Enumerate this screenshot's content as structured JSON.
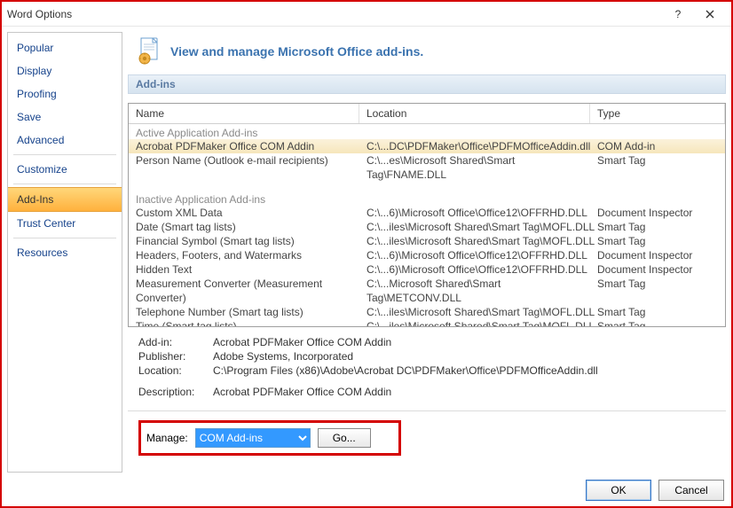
{
  "window": {
    "title": "Word Options"
  },
  "sidebar": {
    "items": [
      {
        "label": "Popular"
      },
      {
        "label": "Display"
      },
      {
        "label": "Proofing"
      },
      {
        "label": "Save"
      },
      {
        "label": "Advanced"
      },
      {
        "label": "Customize"
      },
      {
        "label": "Add-Ins",
        "selected": true
      },
      {
        "label": "Trust Center"
      },
      {
        "label": "Resources"
      }
    ]
  },
  "banner": {
    "text": "View and manage Microsoft Office add-ins."
  },
  "section": {
    "title": "Add-ins"
  },
  "columns": {
    "name": "Name",
    "location": "Location",
    "type": "Type"
  },
  "groups": {
    "active_label": "Active Application Add-ins",
    "inactive_label": "Inactive Application Add-ins"
  },
  "active": [
    {
      "name": "Acrobat PDFMaker Office COM Addin",
      "location": "C:\\...DC\\PDFMaker\\Office\\PDFMOfficeAddin.dll",
      "type": "COM Add-in"
    },
    {
      "name": "Person Name (Outlook e-mail recipients)",
      "location": "C:\\...es\\Microsoft Shared\\Smart Tag\\FNAME.DLL",
      "type": "Smart Tag"
    }
  ],
  "inactive": [
    {
      "name": "Custom XML Data",
      "location": "C:\\...6)\\Microsoft Office\\Office12\\OFFRHD.DLL",
      "type": "Document Inspector"
    },
    {
      "name": "Date (Smart tag lists)",
      "location": "C:\\...iles\\Microsoft Shared\\Smart Tag\\MOFL.DLL",
      "type": "Smart Tag"
    },
    {
      "name": "Financial Symbol (Smart tag lists)",
      "location": "C:\\...iles\\Microsoft Shared\\Smart Tag\\MOFL.DLL",
      "type": "Smart Tag"
    },
    {
      "name": "Headers, Footers, and Watermarks",
      "location": "C:\\...6)\\Microsoft Office\\Office12\\OFFRHD.DLL",
      "type": "Document Inspector"
    },
    {
      "name": "Hidden Text",
      "location": "C:\\...6)\\Microsoft Office\\Office12\\OFFRHD.DLL",
      "type": "Document Inspector"
    },
    {
      "name": "Measurement Converter (Measurement Converter)",
      "location": "C:\\...Microsoft Shared\\Smart Tag\\METCONV.DLL",
      "type": "Smart Tag"
    },
    {
      "name": "Telephone Number (Smart tag lists)",
      "location": "C:\\...iles\\Microsoft Shared\\Smart Tag\\MOFL.DLL",
      "type": "Smart Tag"
    },
    {
      "name": "Time (Smart tag lists)",
      "location": "C:\\...iles\\Microsoft Shared\\Smart Tag\\MOFL.DLL",
      "type": "Smart Tag"
    }
  ],
  "details": {
    "addin_label": "Add-in:",
    "addin_value": "Acrobat PDFMaker Office COM Addin",
    "publisher_label": "Publisher:",
    "publisher_value": "Adobe Systems, Incorporated",
    "location_label": "Location:",
    "location_value": "C:\\Program Files (x86)\\Adobe\\Acrobat DC\\PDFMaker\\Office\\PDFMOfficeAddin.dll",
    "description_label": "Description:",
    "description_value": "Acrobat PDFMaker Office COM Addin"
  },
  "manage": {
    "label": "Manage:",
    "selected": "COM Add-ins",
    "go": "Go..."
  },
  "footer": {
    "ok": "OK",
    "cancel": "Cancel"
  }
}
